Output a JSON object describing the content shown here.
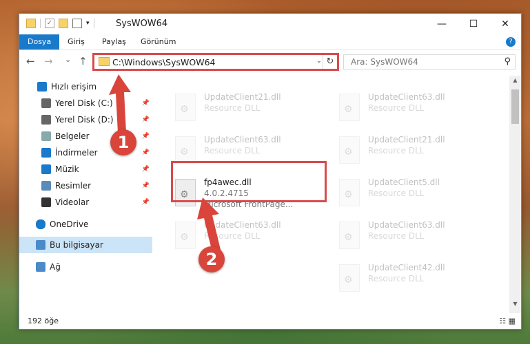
{
  "window": {
    "title": "SysWOW64",
    "minimize": "—",
    "maximize": "☐",
    "close": "✕"
  },
  "ribbon": {
    "tabs": [
      "Dosya",
      "Giriş",
      "Paylaş",
      "Görünüm"
    ],
    "help": "?"
  },
  "nav": {
    "back": "←",
    "forward": "→",
    "recent": "⌄",
    "up": "↑"
  },
  "address": {
    "path": "C:\\Windows\\SysWOW64"
  },
  "search": {
    "placeholder": "Ara: SysWOW64"
  },
  "sidebar": {
    "items": [
      {
        "label": "Hızlı erişim",
        "icon": "star-icon",
        "pinned": false,
        "selected": false
      },
      {
        "label": "Yerel Disk (C:)",
        "icon": "drive-icon",
        "pinned": true,
        "selected": false
      },
      {
        "label": "Yerel Disk (D:)",
        "icon": "drive-icon",
        "pinned": true,
        "selected": false
      },
      {
        "label": "Belgeler",
        "icon": "documents-icon",
        "pinned": true,
        "selected": false
      },
      {
        "label": "İndirmeler",
        "icon": "download-icon",
        "pinned": true,
        "selected": false
      },
      {
        "label": "Müzik",
        "icon": "music-icon",
        "pinned": true,
        "selected": false
      },
      {
        "label": "Resimler",
        "icon": "pictures-icon",
        "pinned": true,
        "selected": false
      },
      {
        "label": "Videolar",
        "icon": "videos-icon",
        "pinned": true,
        "selected": false
      },
      {
        "label": "OneDrive",
        "icon": "cloud-icon",
        "pinned": false,
        "selected": false
      },
      {
        "label": "Bu bilgisayar",
        "icon": "computer-icon",
        "pinned": false,
        "selected": true
      },
      {
        "label": "Ağ",
        "icon": "network-icon",
        "pinned": false,
        "selected": false
      }
    ]
  },
  "files": [
    {
      "name": "UpdateClient21.dll",
      "desc": "Resource DLL",
      "faded": true
    },
    {
      "name": "UpdateClient63.dll",
      "desc": "Resource DLL",
      "faded": true
    },
    {
      "name": "UpdateClient63.dll",
      "desc": "Resource DLL",
      "faded": true
    },
    {
      "name": "UpdateClient21.dll",
      "desc": "Resource DLL",
      "faded": true
    },
    {
      "name": "fp4awec.dll",
      "version": "4.0.2.4715",
      "desc": "Microsoft FrontPage...",
      "faded": false
    },
    {
      "name": "UpdateClient5.dll",
      "desc": "Resource DLL",
      "faded": true
    },
    {
      "name": "UpdateClient63.dll",
      "desc": "Resource DLL",
      "faded": true
    },
    {
      "name": "UpdateClient63.dll",
      "desc": "Resource DLL",
      "faded": true
    },
    {
      "name": "UpdateClient42.dll",
      "desc": "Resource DLL",
      "faded": true
    }
  ],
  "status": {
    "count": "192 öğe"
  },
  "annotations": {
    "step1": "1",
    "step2": "2",
    "highlight_color": "#d94a4a"
  }
}
